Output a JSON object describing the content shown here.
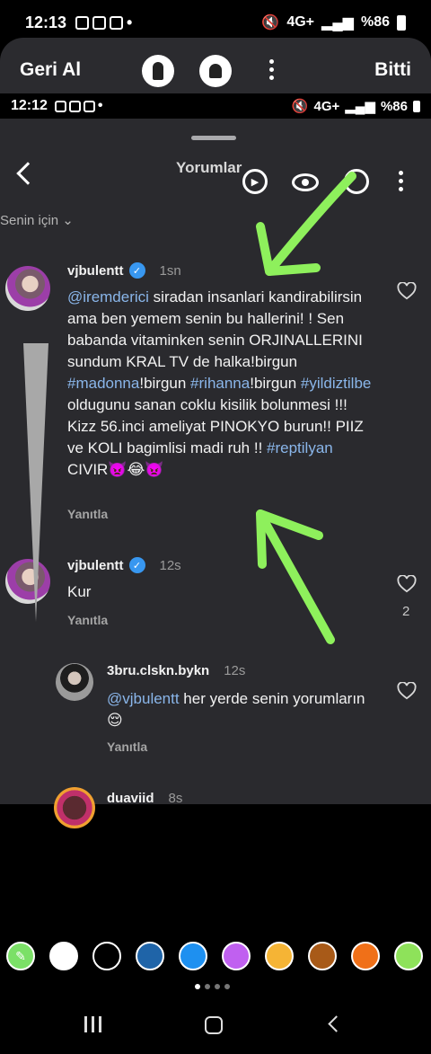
{
  "status_bar": {
    "time": "12:13",
    "network": "4G+",
    "battery": "%86"
  },
  "editor": {
    "undo_label": "Geri Al",
    "done_label": "Bitti"
  },
  "inner_status": {
    "time": "12:12",
    "network": "4G+",
    "battery": "%86"
  },
  "header": {
    "title": "Yorumlar"
  },
  "filter": {
    "label": "Senin için"
  },
  "comments": [
    {
      "username": "vjbulentt",
      "time": "1sn",
      "mention": "@iremderici",
      "text_a": " siradan insanlari kandirabilirsin ama ben yemem senin bu hallerini! ! Sen babanda vitaminken senin ORJINALLERINI  sundum KRAL TV de halka!birgun ",
      "tag_a": "#madonna",
      "text_b": "!birgun ",
      "tag_b": "#rihanna",
      "text_c": "!birgun ",
      "tag_c": "#yildiztilbe",
      "text_d": " oldugunu sanan coklu kisilik bolunmesi !!! Kizz 56.inci  ameliyat  PINOKYO  burun!! PIIZ ve KOLI  bagimlisi madi ruh !! ",
      "tag_d": "#reptilyan",
      "text_e": " CIVIR👿😂👿",
      "reply": "Yanıtla"
    },
    {
      "username": "vjbulentt",
      "time": "12s",
      "text": "Kur",
      "reply": "Yanıtla",
      "likes": "2"
    },
    {
      "username": "3bru.clskn.bykn",
      "time": "12s",
      "mention": "@vjbulentt",
      "text": " her yerde senin yorumların 😌",
      "reply": "Yanıtla"
    },
    {
      "username": "duaviid",
      "time": "8s"
    }
  ],
  "colors": {
    "background": "#2a2a2e",
    "link": "#8ab6ea",
    "verified": "#3897f0",
    "arrow": "#8ef05c"
  },
  "palette": [
    "#7be067",
    "#ffffff",
    "#000000",
    "#1f64a8",
    "#1e90f0",
    "#c060f0",
    "#f5b435",
    "#a85a18",
    "#f07018",
    "#8ee25a"
  ]
}
